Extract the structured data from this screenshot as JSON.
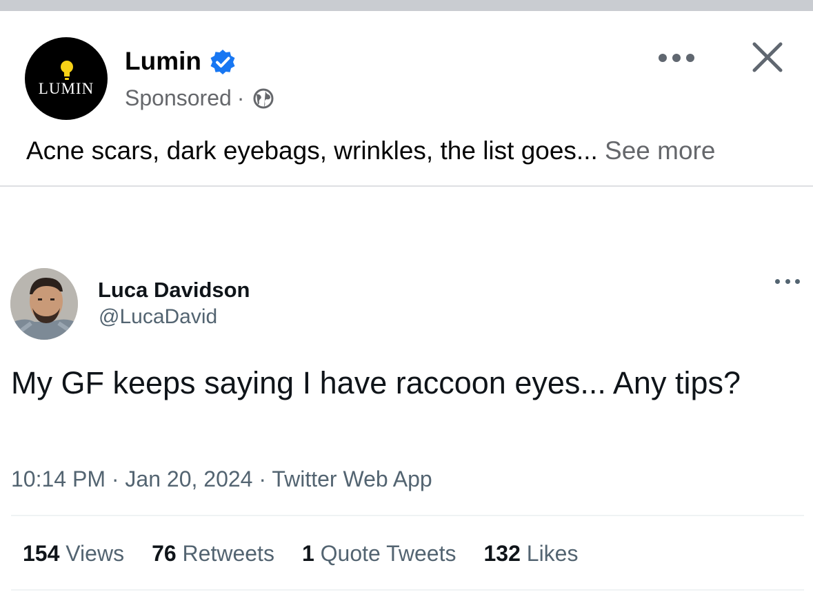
{
  "post": {
    "avatar_text": "LUMIN",
    "page_name": "Lumin",
    "sponsored": "Sponsored",
    "separator": "·",
    "caption": "Acne scars, dark eyebags, wrinkles, the list goes...",
    "see_more": "See more"
  },
  "tweet": {
    "name": "Luca Davidson",
    "handle": "@LucaDavid",
    "text": "My GF keeps saying I have raccoon eyes... Any tips?",
    "meta": "10:14 PM · Jan 20, 2024 · Twitter Web App",
    "stats": [
      {
        "count": "154",
        "label": "Views"
      },
      {
        "count": "76",
        "label": "Retweets"
      },
      {
        "count": "1",
        "label": "Quote Tweets"
      },
      {
        "count": "132",
        "label": "Likes"
      }
    ]
  },
  "icons": {
    "verified": "verified-badge-icon",
    "globe": "globe-icon",
    "more": "more-options-icon",
    "close": "close-icon",
    "bulb": "lightbulb-icon"
  },
  "colors": {
    "verified_blue": "#1877f2",
    "bulb_yellow": "#f7d117",
    "secondary_text": "#65676b",
    "twitter_secondary": "#536471"
  }
}
